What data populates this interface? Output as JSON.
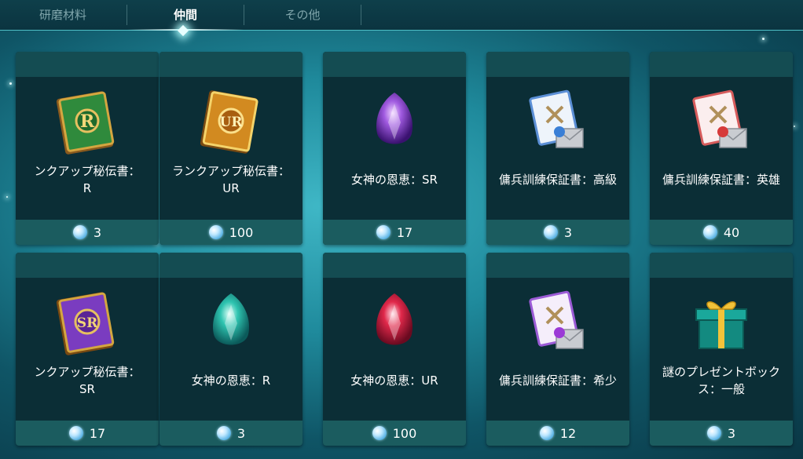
{
  "tabs": [
    {
      "label": "研磨材料",
      "active": false
    },
    {
      "label": "仲間",
      "active": true
    },
    {
      "label": "その他",
      "active": false
    }
  ],
  "items": [
    {
      "name": "ンクアップ秘伝書：\nR",
      "price": "3",
      "icon": "green-rank-book-icon"
    },
    {
      "name": "ランクアップ秘伝書：\nUR",
      "price": "100",
      "icon": "gold-rank-book-icon"
    },
    {
      "name": "女神の恩恵：SR",
      "price": "17",
      "icon": "purple-crystal-icon"
    },
    {
      "name": "傭兵訓練保証書：高級",
      "price": "3",
      "icon": "blue-certificate-icon"
    },
    {
      "name": "傭兵訓練保証書：英雄",
      "price": "40",
      "icon": "red-certificate-icon"
    },
    {
      "name": "ンクアップ秘伝書：\nSR",
      "price": "17",
      "icon": "purple-rank-book-icon"
    },
    {
      "name": "女神の恩恵：R",
      "price": "3",
      "icon": "teal-crystal-icon"
    },
    {
      "name": "女神の恩恵：UR",
      "price": "100",
      "icon": "red-crystal-icon"
    },
    {
      "name": "傭兵訓練保証書：希少",
      "price": "12",
      "icon": "purple-certificate-icon"
    },
    {
      "name": "謎のプレゼントボック\nス：一般",
      "price": "3",
      "icon": "gift-box-icon"
    }
  ],
  "currency_icon": "diamond-gem-icon",
  "colors": {
    "accent": "#4fc0c6",
    "card_bg": "#0b2e36",
    "card_header": "#144c52",
    "price_bar": "#1b5c5f"
  }
}
